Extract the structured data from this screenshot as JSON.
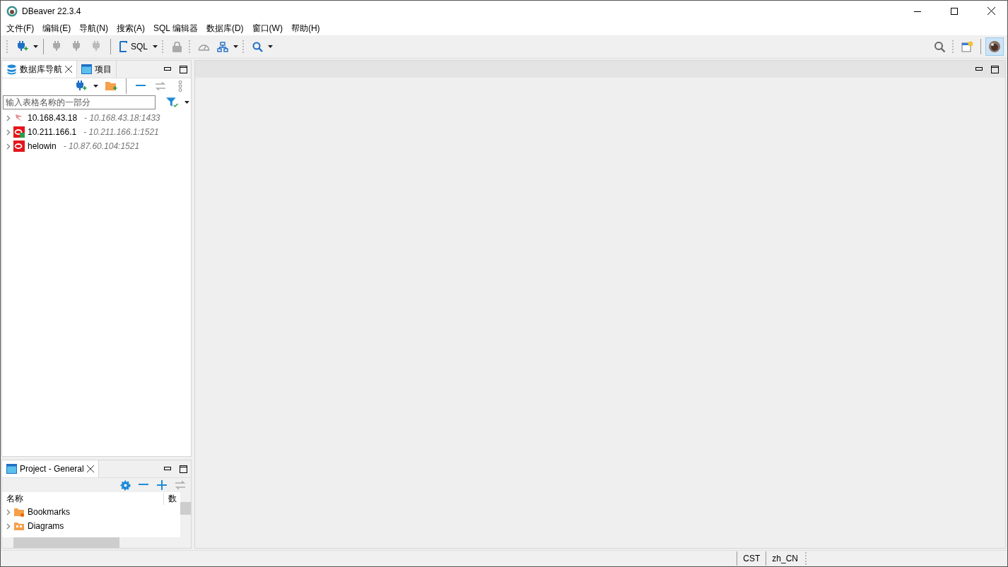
{
  "window": {
    "title": "DBeaver 22.3.4"
  },
  "menu": [
    "文件(F)",
    "编辑(E)",
    "导航(N)",
    "搜索(A)",
    "SQL 编辑器",
    "数据库(D)",
    "窗口(W)",
    "帮助(H)"
  ],
  "toolbar": {
    "sql_label": "SQL"
  },
  "navigator": {
    "tabs": [
      {
        "label": "数据库导航",
        "selected": true
      },
      {
        "label": "项目",
        "selected": false
      }
    ],
    "filter": {
      "placeholder": "输入表格名称的一部分"
    },
    "connections": [
      {
        "name": "10.168.43.18",
        "address": "- 10.168.43.18:1433",
        "kind": "sqlserver",
        "connected": false
      },
      {
        "name": "10.211.166.1",
        "address": "- 10.211.166.1:1521",
        "kind": "oracle",
        "connected": true
      },
      {
        "name": "helowin",
        "address": "- 10.87.60.104:1521",
        "kind": "oracle",
        "connected": false
      }
    ]
  },
  "project": {
    "tab": {
      "label": "Project - General",
      "selected": true
    },
    "columns": [
      "名称",
      "数"
    ],
    "rows": [
      {
        "name": "Bookmarks",
        "kind": "bookmarks"
      },
      {
        "name": "Diagrams",
        "kind": "diagrams"
      }
    ]
  },
  "status_bar": {
    "timezone": "CST",
    "locale": "zh_CN"
  }
}
